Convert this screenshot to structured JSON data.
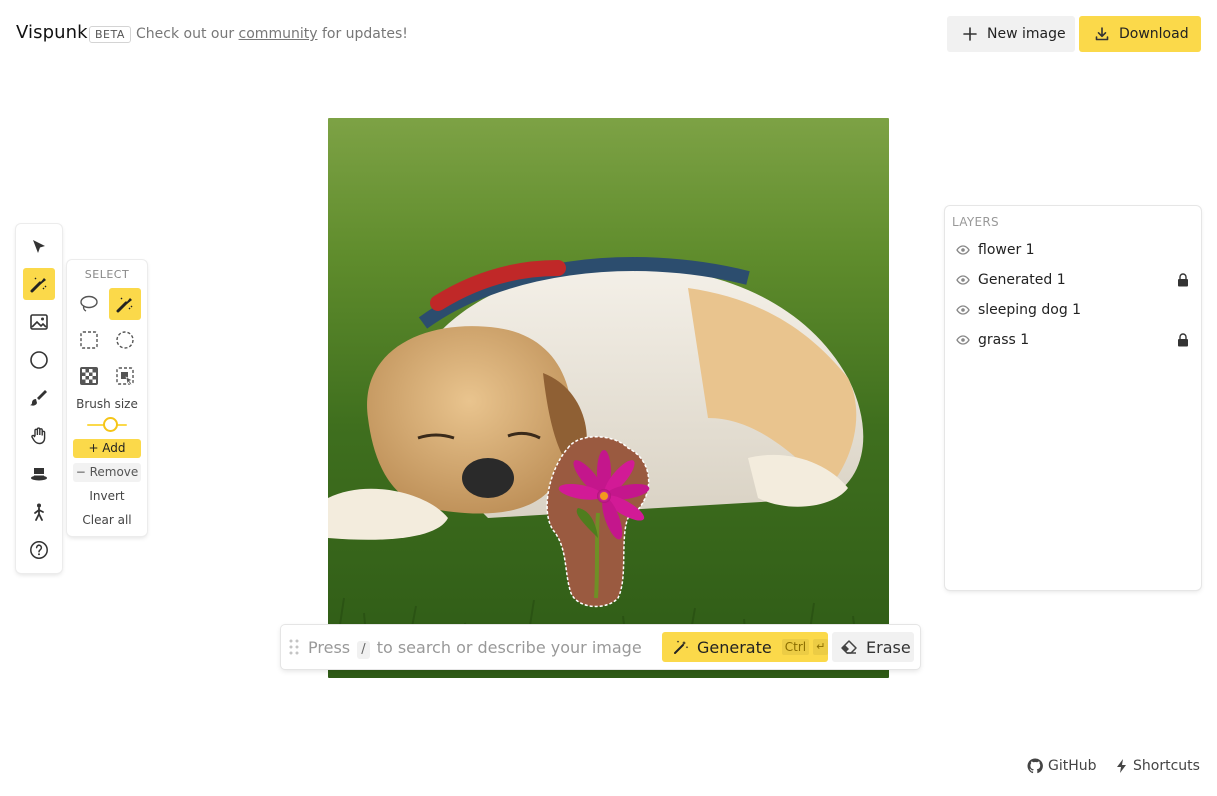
{
  "header": {
    "brand": "Vispunk",
    "badge": "BETA",
    "tagline_pre": "Check out our",
    "tagline_link": "community",
    "tagline_post": "for updates!",
    "new_image_label": "New image",
    "download_label": "Download"
  },
  "toolbar": {
    "tools": [
      "pointer-icon",
      "magic-brush-icon",
      "image-icon",
      "circle-icon",
      "brush-icon",
      "hand-icon",
      "hat-icon",
      "person-icon",
      "help-icon"
    ],
    "active_tool": "magic-brush-icon"
  },
  "select_panel": {
    "title": "SELECT",
    "brush_size_label": "Brush size",
    "brush_size": 0.6,
    "add_label": "+ Add",
    "remove_label": "− Remove",
    "invert_label": "Invert",
    "clear_label": "Clear all"
  },
  "layers": {
    "title": "LAYERS",
    "items": [
      {
        "name": "flower 1",
        "locked": false
      },
      {
        "name": "Generated 1",
        "locked": true
      },
      {
        "name": "sleeping dog 1",
        "locked": false
      },
      {
        "name": "grass 1",
        "locked": true
      }
    ]
  },
  "prompt": {
    "ph_pre": "Press",
    "ph_key": "/",
    "ph_post": "to search or describe your image",
    "generate_label": "Generate",
    "generate_shortcut": "Ctrl",
    "generate_enter": "↵",
    "erase_label": "Erase"
  },
  "footer": {
    "github_label": "GitHub",
    "shortcuts_label": "Shortcuts"
  },
  "colors": {
    "accent": "#fbd94a",
    "button_gray": "#f1f1f1"
  }
}
